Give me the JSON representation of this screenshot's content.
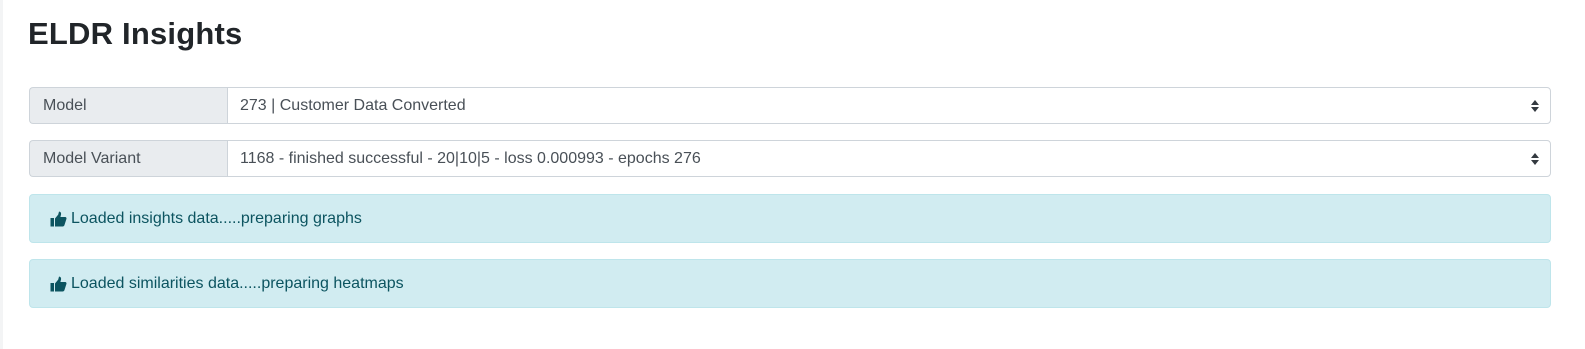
{
  "page": {
    "title": "ELDR Insights"
  },
  "model_select": {
    "label": "Model",
    "value": "273 | Customer Data Converted"
  },
  "variant_select": {
    "label": "Model Variant",
    "value": "1168 - finished successful - 20|10|5 - loss 0.000993 - epochs 276"
  },
  "alerts": [
    {
      "icon": "thumbs-up-icon",
      "text": "Loaded insights data.....preparing graphs"
    },
    {
      "icon": "thumbs-up-icon",
      "text": "Loaded similarities data.....preparing heatmaps"
    }
  ],
  "colors": {
    "alert_background": "#d1ecf1",
    "alert_text": "#0c5460",
    "label_background": "#e9ecef"
  }
}
